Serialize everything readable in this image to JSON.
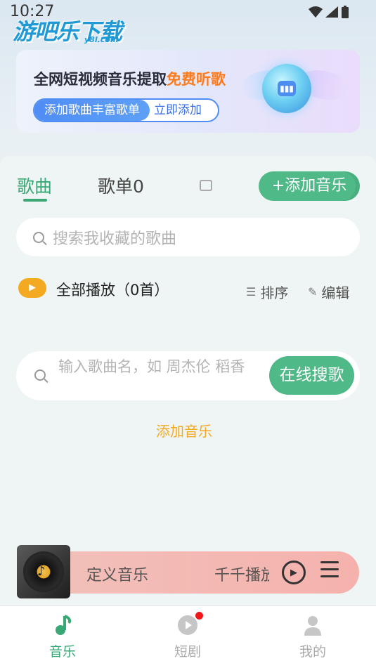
{
  "status_bar": {
    "time": "10:27"
  },
  "logo": {
    "name": "游吧乐下载",
    "sub": "y8l.com"
  },
  "banner": {
    "title": "全网短视频音乐提取",
    "title_highlight": "免费听歌",
    "pill_left": "添加歌曲丰富歌单",
    "pill_right": "立即添加"
  },
  "tabs": {
    "songs": "歌曲",
    "playlists": "歌单0"
  },
  "add_music_button": "+添加音乐",
  "favorites_search": {
    "placeholder": "搜索我收藏的歌曲"
  },
  "play_all": {
    "label": "全部播放（0首）"
  },
  "sort": {
    "label": "排序"
  },
  "edit": {
    "label": "编辑"
  },
  "online_search": {
    "placeholder": "输入歌曲名，如 周杰伦 稻香",
    "button": "在线搜歌"
  },
  "add_music_link": "添加音乐",
  "player": {
    "title": "定义音乐",
    "scroll_text": "千千播放"
  },
  "nav": {
    "music": "音乐",
    "drama": "短剧",
    "mine": "我的"
  },
  "colors": {
    "accent": "#4fb987",
    "orange": "#f3a922",
    "banner_blue": "#4f8df5"
  }
}
